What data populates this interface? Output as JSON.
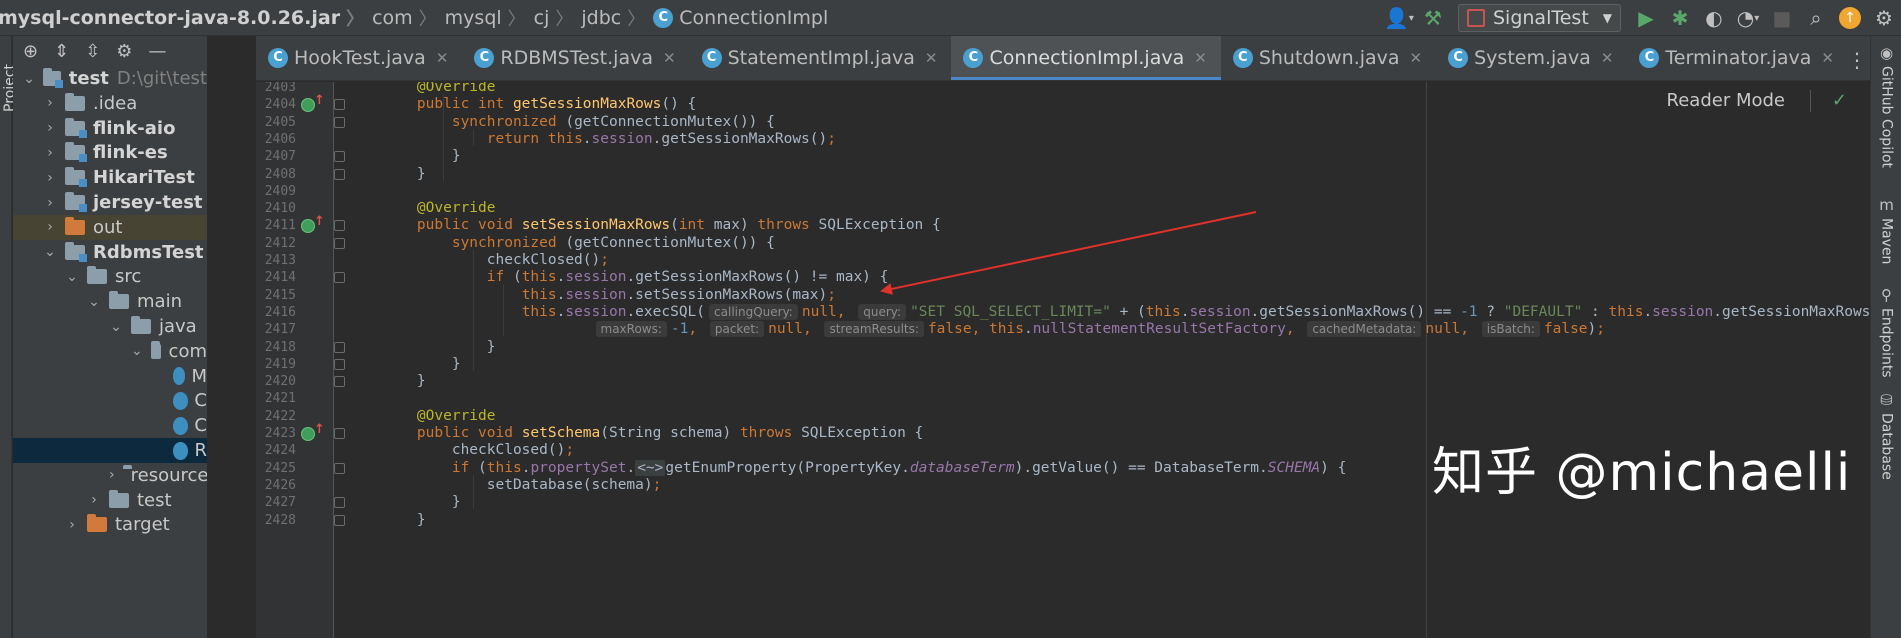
{
  "breadcrumbs": [
    {
      "label": "mysql-connector-java-8.0.26.jar",
      "icon": "jar-icon"
    },
    {
      "label": "com"
    },
    {
      "label": "mysql"
    },
    {
      "label": "cj"
    },
    {
      "label": "jdbc"
    },
    {
      "label": "ConnectionImpl",
      "icon": "class-icon"
    }
  ],
  "toolbar": {
    "run_config": "SignalTest",
    "icons": [
      "user-icon",
      "build-hammer-icon",
      "run-icon",
      "debug-icon",
      "coverage-icon",
      "profiler-icon",
      "stop-icon",
      "search-icon",
      "update-icon"
    ]
  },
  "left_tool_label": "Project",
  "project_toolbar_icons": [
    "select-opened-file-icon",
    "expand-all-icon",
    "collapse-all-icon",
    "settings-icon",
    "hide-icon"
  ],
  "project_tree": [
    {
      "label": "test",
      "extra": "D:\\git\\test",
      "bold": true,
      "expanded": true
    },
    {
      "label": ".idea",
      "expanded": false
    },
    {
      "label": "flink-aio",
      "bold": true,
      "expanded": false
    },
    {
      "label": "flink-es",
      "bold": true,
      "expanded": false
    },
    {
      "label": "HikariTest",
      "bold": true,
      "expanded": false
    },
    {
      "label": "jersey-test",
      "bold": true,
      "expanded": false
    },
    {
      "label": "out",
      "expanded": false
    },
    {
      "label": "RdbmsTest",
      "bold": true,
      "expanded": true
    },
    {
      "label": "src",
      "expanded": true
    },
    {
      "label": "main",
      "expanded": true
    },
    {
      "label": "java",
      "expanded": true
    },
    {
      "label": "com",
      "expanded": true
    },
    {
      "label": "M"
    },
    {
      "label": "C"
    },
    {
      "label": "C"
    },
    {
      "label": "R"
    },
    {
      "label": "resources",
      "expanded": false
    },
    {
      "label": "test",
      "expanded": false
    },
    {
      "label": "target",
      "expanded": false
    }
  ],
  "tabs": [
    {
      "label": "HookTest.java",
      "active": false
    },
    {
      "label": "RDBMSTest.java",
      "active": false
    },
    {
      "label": "StatementImpl.java",
      "active": false
    },
    {
      "label": "ConnectionImpl.java",
      "active": true
    },
    {
      "label": "Shutdown.java",
      "active": false
    },
    {
      "label": "System.java",
      "active": false
    },
    {
      "label": "Terminator.java",
      "active": false
    }
  ],
  "editor": {
    "reader_mode": "Reader Mode",
    "line_numbers": [
      "2403",
      "2404",
      "2405",
      "2406",
      "2407",
      "2408",
      "2409",
      "2410",
      "2411",
      "2412",
      "2413",
      "2414",
      "2415",
      "2416",
      "2417",
      "2418",
      "2419",
      "2420",
      "2421",
      "2422",
      "2423",
      "2424",
      "2425",
      "2426",
      "2427",
      "2428"
    ],
    "lines": [
      [
        {
          "t": "    "
        },
        {
          "t": "@Override",
          "c": "an"
        }
      ],
      [
        {
          "t": "    "
        },
        {
          "t": "public int ",
          "c": "kw"
        },
        {
          "t": "getSessionMaxRows",
          "c": "fn"
        },
        {
          "t": "() {"
        }
      ],
      [
        {
          "t": "        "
        },
        {
          "t": "synchronized ",
          "c": "kw"
        },
        {
          "t": "(getConnectionMutex()) {"
        }
      ],
      [
        {
          "t": "            "
        },
        {
          "t": "return this",
          "c": "kw"
        },
        {
          "t": "."
        },
        {
          "t": "session",
          "c": "fd"
        },
        {
          "t": ".getSessionMaxRows()"
        },
        {
          "t": ";",
          "c": "kw"
        }
      ],
      [
        {
          "t": "        }"
        }
      ],
      [
        {
          "t": "    }"
        }
      ],
      [],
      [
        {
          "t": "    "
        },
        {
          "t": "@Override",
          "c": "an"
        }
      ],
      [
        {
          "t": "    "
        },
        {
          "t": "public void ",
          "c": "kw"
        },
        {
          "t": "setSessionMaxRows",
          "c": "fn"
        },
        {
          "t": "("
        },
        {
          "t": "int ",
          "c": "kw"
        },
        {
          "t": "max) "
        },
        {
          "t": "throws ",
          "c": "kw"
        },
        {
          "t": "SQLException {"
        }
      ],
      [
        {
          "t": "        "
        },
        {
          "t": "synchronized ",
          "c": "kw"
        },
        {
          "t": "(getConnectionMutex()) {"
        }
      ],
      [
        {
          "t": "            checkClosed()"
        },
        {
          "t": ";",
          "c": "kw"
        }
      ],
      [
        {
          "t": "            "
        },
        {
          "t": "if ",
          "c": "kw"
        },
        {
          "t": "("
        },
        {
          "t": "this",
          "c": "kw"
        },
        {
          "t": "."
        },
        {
          "t": "session",
          "c": "fd"
        },
        {
          "t": ".getSessionMaxRows() != max) {"
        }
      ],
      [
        {
          "t": "                "
        },
        {
          "t": "this",
          "c": "kw"
        },
        {
          "t": "."
        },
        {
          "t": "session",
          "c": "fd"
        },
        {
          "t": ".setSessionMaxRows(max)"
        },
        {
          "t": ";",
          "c": "kw"
        }
      ],
      [
        {
          "t": "                "
        },
        {
          "t": "this",
          "c": "kw"
        },
        {
          "t": "."
        },
        {
          "t": "session",
          "c": "fd"
        },
        {
          "t": ".execSQL("
        },
        {
          "t": "callingQuery:",
          "c": "hint"
        },
        {
          "t": "null, ",
          "c": "kw"
        },
        {
          "t": "query:",
          "c": "hint"
        },
        {
          "t": "\"SET SQL_SELECT_LIMIT=\" ",
          "c": "st"
        },
        {
          "t": "+ ("
        },
        {
          "t": "this",
          "c": "kw"
        },
        {
          "t": "."
        },
        {
          "t": "session",
          "c": "fd"
        },
        {
          "t": ".getSessionMaxRows() == "
        },
        {
          "t": "-1 ",
          "c": "nm"
        },
        {
          "t": "? "
        },
        {
          "t": "\"DEFAULT\" ",
          "c": "st"
        },
        {
          "t": ": "
        },
        {
          "t": "this",
          "c": "kw"
        },
        {
          "t": "."
        },
        {
          "t": "session",
          "c": "fd"
        },
        {
          "t": ".getSessionMaxRows())"
        }
      ],
      [
        {
          "t": "                        "
        },
        {
          "t": "maxRows:",
          "c": "hint"
        },
        {
          "t": "-1",
          "c": "nm"
        },
        {
          "t": ", ",
          "c": "kw"
        },
        {
          "t": "packet:",
          "c": "hint"
        },
        {
          "t": "null, ",
          "c": "kw"
        },
        {
          "t": "streamResults:",
          "c": "hint"
        },
        {
          "t": "false, this",
          "c": "kw"
        },
        {
          "t": "."
        },
        {
          "t": "nullStatementResultSetFactory",
          "c": "fd"
        },
        {
          "t": ", ",
          "c": "kw"
        },
        {
          "t": "cachedMetadata:",
          "c": "hint"
        },
        {
          "t": "null, ",
          "c": "kw"
        },
        {
          "t": "isBatch:",
          "c": "hint"
        },
        {
          "t": "false",
          "c": "kw"
        },
        {
          "t": ")"
        },
        {
          "t": ";",
          "c": "kw"
        }
      ],
      [
        {
          "t": "            }"
        }
      ],
      [
        {
          "t": "        }"
        }
      ],
      [
        {
          "t": "    }"
        }
      ],
      [],
      [
        {
          "t": "    "
        },
        {
          "t": "@Override",
          "c": "an"
        }
      ],
      [
        {
          "t": "    "
        },
        {
          "t": "public void ",
          "c": "kw"
        },
        {
          "t": "setSchema",
          "c": "fn"
        },
        {
          "t": "(String schema) "
        },
        {
          "t": "throws ",
          "c": "kw"
        },
        {
          "t": "SQLException {"
        }
      ],
      [
        {
          "t": "        checkClosed()"
        },
        {
          "t": ";",
          "c": "kw"
        }
      ],
      [
        {
          "t": "        "
        },
        {
          "t": "if ",
          "c": "kw"
        },
        {
          "t": "("
        },
        {
          "t": "this",
          "c": "kw"
        },
        {
          "t": "."
        },
        {
          "t": "propertySet",
          "c": "fd"
        },
        {
          "t": "."
        },
        {
          "t": "<~>",
          "c": "fold"
        },
        {
          "t": "getEnumProperty(PropertyKey."
        },
        {
          "t": "databaseTerm",
          "c": "it"
        },
        {
          "t": ").getValue() == DatabaseTerm."
        },
        {
          "t": "SCHEMA",
          "c": "it"
        },
        {
          "t": ") {"
        }
      ],
      [
        {
          "t": "            setDatabase(schema)"
        },
        {
          "t": ";",
          "c": "kw"
        }
      ],
      [
        {
          "t": "        }"
        }
      ],
      [
        {
          "t": "    }"
        }
      ]
    ]
  },
  "watermark": "知乎 @michaelli",
  "right_tools": [
    {
      "label": "GitHub Copilot",
      "icon": "copilot-icon"
    },
    {
      "label": "Maven",
      "icon": "maven-icon"
    },
    {
      "label": "Endpoints",
      "icon": "endpoints-icon"
    },
    {
      "label": "Database",
      "icon": "database-icon"
    }
  ],
  "colors": {
    "accent": "#4a88c7",
    "arrow": "#e0312a",
    "selection": "#0d293e",
    "editor_bg": "#2b2b2b"
  }
}
